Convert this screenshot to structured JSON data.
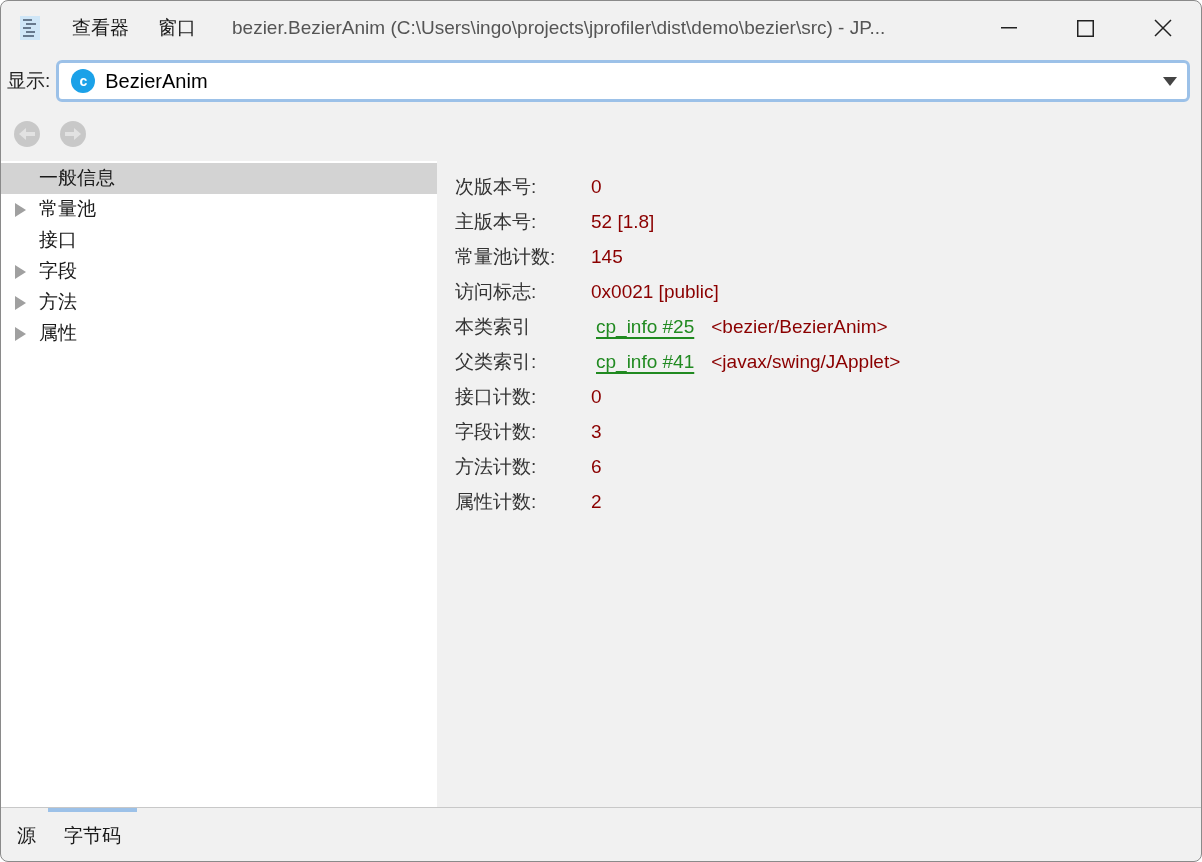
{
  "window": {
    "menu": [
      "查看器",
      "窗口"
    ],
    "title": "bezier.BezierAnim (C:\\Users\\ingo\\projects\\jprofiler\\dist\\demo\\bezier\\src) - JP..."
  },
  "show": {
    "label": "显示:",
    "badge": "c",
    "value": "BezierAnim"
  },
  "tree": [
    {
      "label": "一般信息",
      "expandable": false,
      "selected": true
    },
    {
      "label": "常量池",
      "expandable": true,
      "selected": false
    },
    {
      "label": "接口",
      "expandable": false,
      "selected": false
    },
    {
      "label": "字段",
      "expandable": true,
      "selected": false
    },
    {
      "label": "方法",
      "expandable": true,
      "selected": false
    },
    {
      "label": "属性",
      "expandable": true,
      "selected": false
    }
  ],
  "properties": [
    {
      "kind": "plain",
      "label": "次版本号:",
      "value": "0"
    },
    {
      "kind": "plain",
      "label": "主版本号:",
      "value": "52 [1.8]"
    },
    {
      "kind": "plain",
      "label": "常量池计数:",
      "value": "145"
    },
    {
      "kind": "plain",
      "label": "访问标志:",
      "value": "0x0021 [public]"
    },
    {
      "kind": "reference",
      "label": "本类索引",
      "link": "cp_info #25",
      "value": "<bezier/BezierAnim>"
    },
    {
      "kind": "reference",
      "label": "父类索引:",
      "link": "cp_info #41",
      "value": "<javax/swing/JApplet>"
    },
    {
      "kind": "plain",
      "label": "接口计数:",
      "value": "0"
    },
    {
      "kind": "plain",
      "label": "字段计数:",
      "value": "3"
    },
    {
      "kind": "plain",
      "label": "方法计数:",
      "value": "6"
    },
    {
      "kind": "plain",
      "label": "属性计数:",
      "value": "2"
    }
  ],
  "bottom_tabs": [
    {
      "label": "源",
      "selected": false
    },
    {
      "label": "字节码",
      "selected": true
    }
  ]
}
